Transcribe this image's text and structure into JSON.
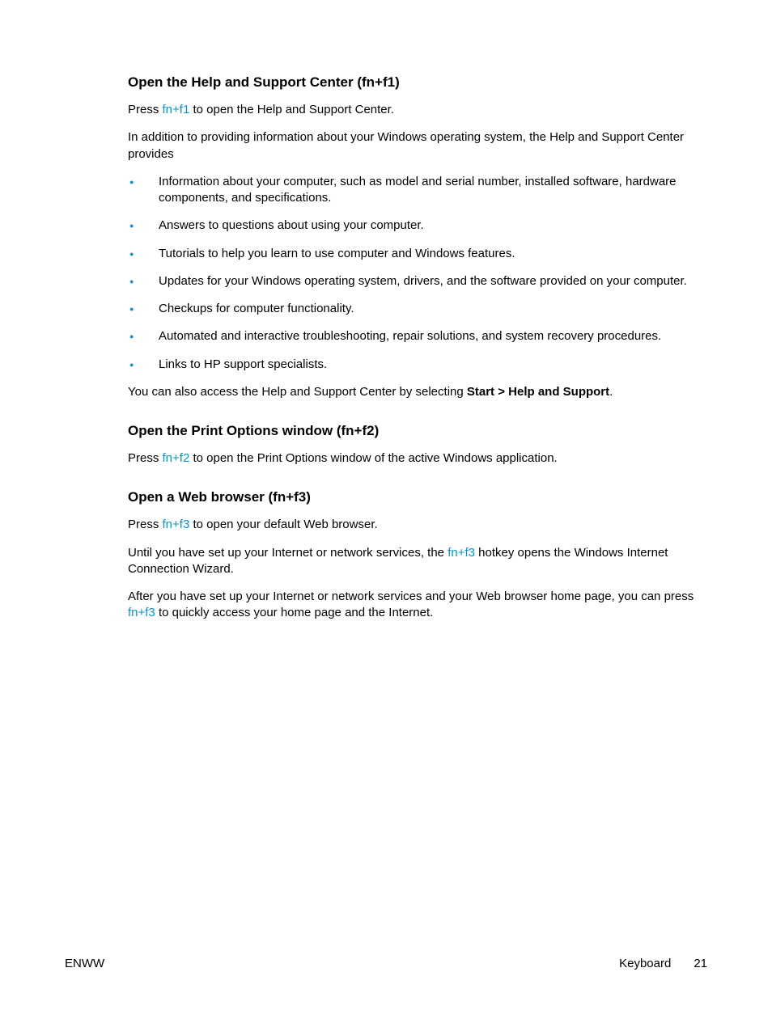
{
  "section1": {
    "heading": "Open the Help and Support Center (fn+f1)",
    "p1_a": "Press ",
    "p1_hotkey": "fn+f1",
    "p1_b": " to open the Help and Support Center.",
    "p2": "In addition to providing information about your Windows operating system, the Help and Support Center provides",
    "bullets": [
      "Information about your computer, such as model and serial number, installed software, hardware components, and specifications.",
      "Answers to questions about using your computer.",
      "Tutorials to help you learn to use computer and Windows features.",
      "Updates for your Windows operating system, drivers, and the software provided on your computer.",
      "Checkups for computer functionality.",
      "Automated and interactive troubleshooting, repair solutions, and system recovery procedures.",
      "Links to HP support specialists."
    ],
    "p3_a": "You can also access the Help and Support Center by selecting ",
    "p3_bold": "Start > Help and Support",
    "p3_b": "."
  },
  "section2": {
    "heading": "Open the Print Options window (fn+f2)",
    "p1_a": "Press ",
    "p1_hotkey": "fn+f2",
    "p1_b": " to open the Print Options window of the active Windows application."
  },
  "section3": {
    "heading": "Open a Web browser (fn+f3)",
    "p1_a": "Press ",
    "p1_hotkey": "fn+f3",
    "p1_b": " to open your default Web browser.",
    "p2_a": "Until you have set up your Internet or network services, the ",
    "p2_hotkey": "fn+f3",
    "p2_b": " hotkey opens the Windows Internet Connection Wizard.",
    "p3_a": "After you have set up your Internet or network services and your Web browser home page, you can press ",
    "p3_hotkey": "fn+f3",
    "p3_b": " to quickly access your home page and the Internet."
  },
  "footer": {
    "left": "ENWW",
    "section": "Keyboard",
    "page": "21"
  }
}
